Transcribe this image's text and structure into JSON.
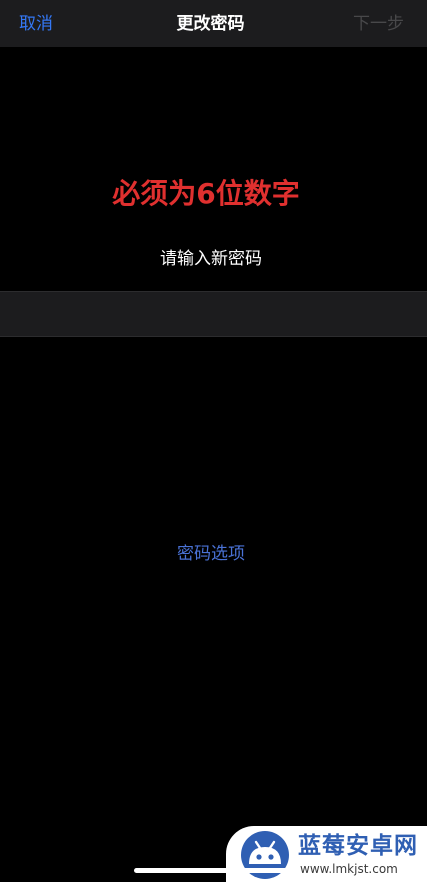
{
  "colors": {
    "accent": "#3478f6",
    "link_blue": "#4a72d6",
    "error_red": "#e0302f",
    "disabled": "#48484a",
    "watermark_blue": "#2f5fb3"
  },
  "nav": {
    "cancel_label": "取消",
    "title": "更改密码",
    "next_label": "下一步"
  },
  "main": {
    "error_message": "必须为6位数字",
    "prompt": "请输入新密码",
    "options_label": "密码选项"
  },
  "watermark": {
    "title": "蓝莓安卓网",
    "url": "www.lmkjst.com"
  }
}
